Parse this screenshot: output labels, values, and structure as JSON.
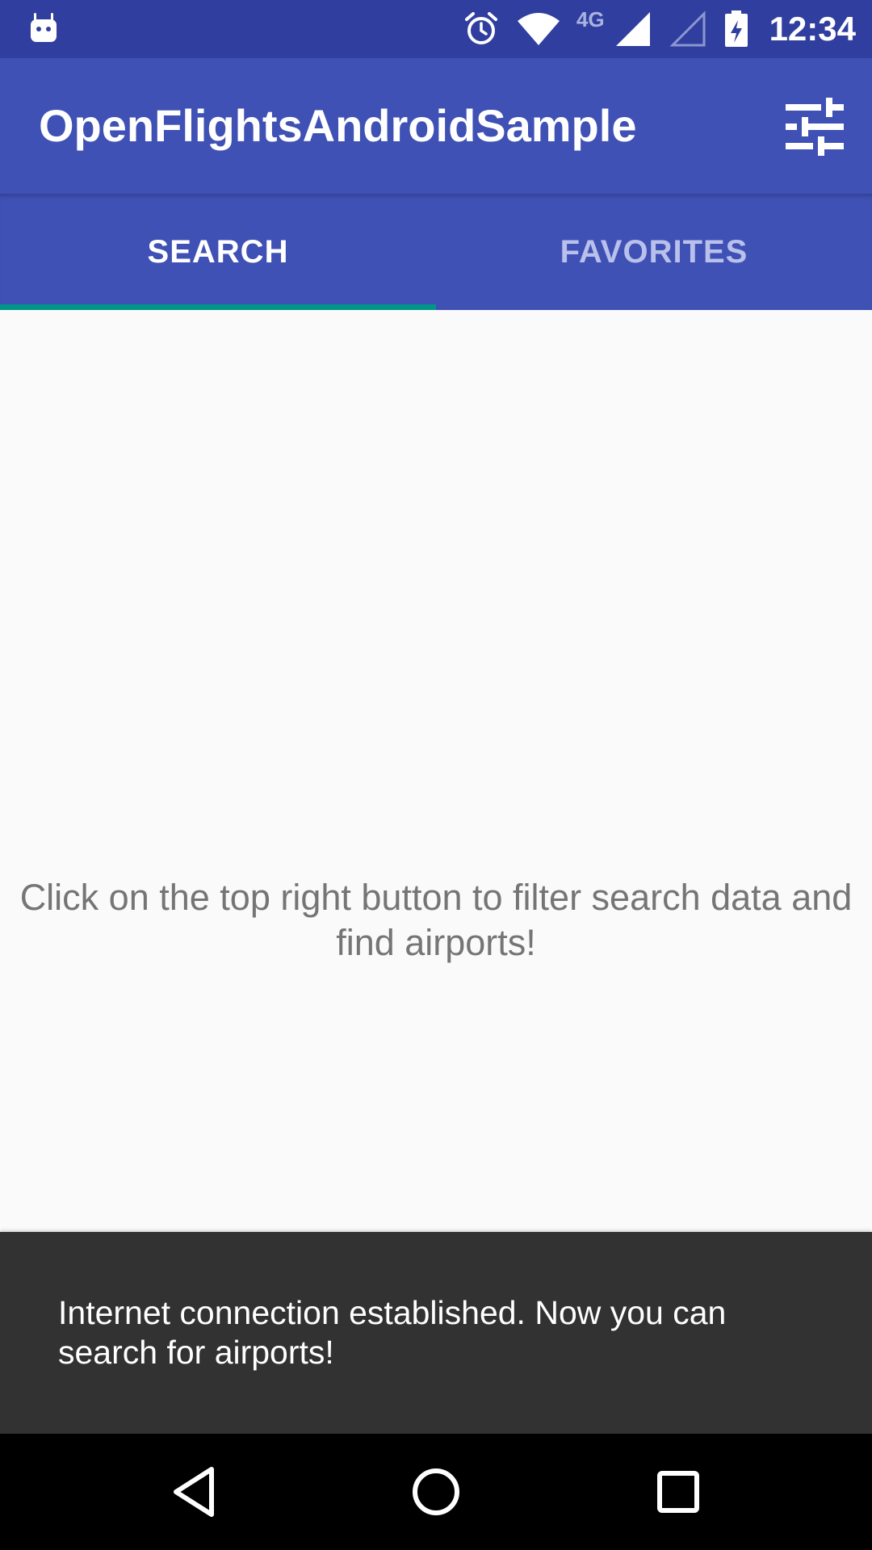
{
  "status_bar": {
    "network_type": "4G",
    "time": "12:34",
    "icons": [
      "android-icon",
      "alarm-icon",
      "wifi-icon",
      "signal-full-icon",
      "signal-empty-icon",
      "battery-charging-icon"
    ]
  },
  "app_bar": {
    "title": "OpenFlightsAndroidSample",
    "action_icon": "filter-sliders-icon"
  },
  "tabs": [
    {
      "label": "SEARCH",
      "selected": true
    },
    {
      "label": "FAVORITES",
      "selected": false
    }
  ],
  "content": {
    "empty_message": "Click on the top right button to filter search data and find airports!"
  },
  "snackbar": {
    "message": "Internet connection established. Now you can search for airports!"
  },
  "nav_bar": {
    "icons": [
      "back-icon",
      "home-icon",
      "recents-icon"
    ]
  },
  "colors": {
    "primary": "#3f51b5",
    "primary_dark": "#303f9f",
    "accent": "#009688",
    "snackbar": "#323232",
    "background": "#fafafa"
  }
}
